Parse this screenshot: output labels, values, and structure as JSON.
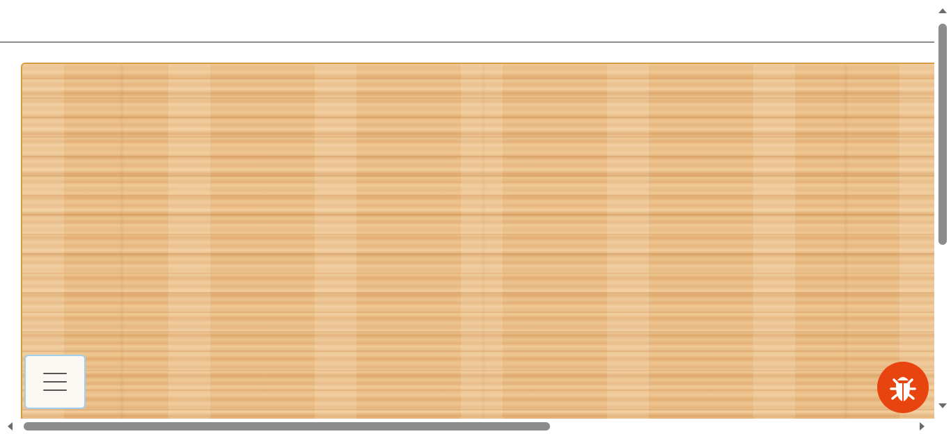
{
  "app": {
    "icons": {
      "menu": "hamburger-icon",
      "bug": "bug-icon"
    },
    "colors": {
      "header_border": "#2b2b2b",
      "board_border": "#d99a45",
      "wood_base": "#e9bd86",
      "menu_button_bg": "#fbf7f2",
      "menu_button_border": "#9fd0f0",
      "bug_button_bg": "#e8440f",
      "scrollbar_thumb": "#8c8c8c"
    },
    "scroll": {
      "vertical_position_fraction": 0.0,
      "horizontal_position_fraction": 0.0
    }
  }
}
